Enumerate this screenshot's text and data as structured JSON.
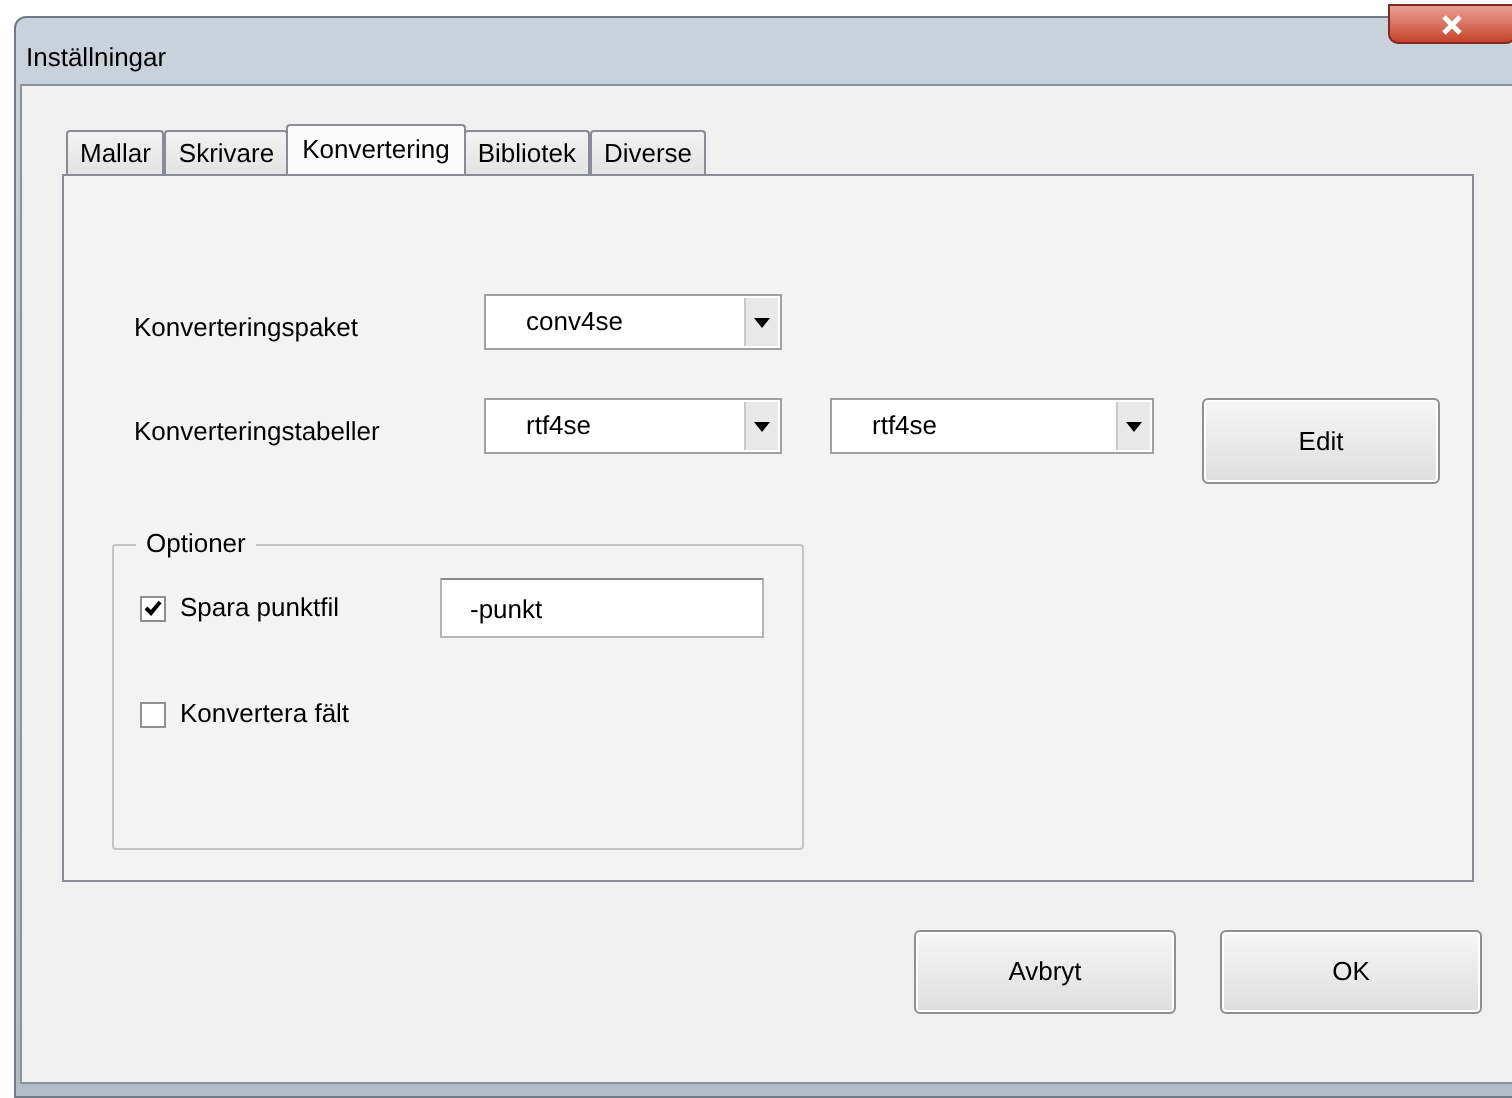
{
  "window": {
    "title": "Inställningar"
  },
  "tabs": [
    {
      "label": "Mallar",
      "selected": false
    },
    {
      "label": "Skrivare",
      "selected": false
    },
    {
      "label": "Konvertering",
      "selected": true
    },
    {
      "label": "Bibliotek",
      "selected": false
    },
    {
      "label": "Diverse",
      "selected": false
    }
  ],
  "rows": [
    {
      "label": "Konverteringspaket",
      "dropdowns": [
        {
          "value": "conv4se"
        }
      ]
    },
    {
      "label": "Konverteringstabeller",
      "dropdowns": [
        {
          "value": "rtf4se"
        },
        {
          "value": "rtf4se"
        }
      ],
      "button": "Edit"
    }
  ],
  "options_group": {
    "title": "Optioner",
    "items": [
      {
        "label": "Spara punktfil",
        "checked": true,
        "value": "-punkt"
      },
      {
        "label": "Konvertera fält",
        "checked": false
      }
    ]
  },
  "buttons": [
    "Avbryt",
    "OK"
  ]
}
